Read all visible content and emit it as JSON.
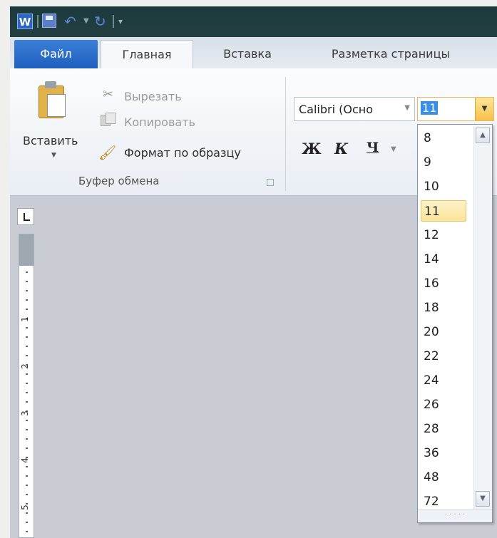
{
  "app": {
    "logo_letter": "W"
  },
  "quick_access": {
    "icons": [
      "word-logo-icon",
      "save-icon",
      "undo-icon",
      "dropdown-arrow-icon",
      "redo-icon",
      "customize-icon"
    ]
  },
  "tabs": {
    "file": "Файл",
    "home": "Главная",
    "insert": "Вставка",
    "page_layout": "Разметка страницы"
  },
  "clipboard": {
    "paste_label": "Вставить",
    "cut_label": "Вырезать",
    "copy_label": "Копировать",
    "format_painter_label": "Формат по образцу",
    "group_label": "Буфер обмена"
  },
  "font": {
    "name_value": "Calibri (Осно",
    "size_value": "11",
    "bold_label": "Ж",
    "italic_label": "К",
    "underline_label": "Ч"
  },
  "font_size_dropdown": {
    "options": [
      "8",
      "9",
      "10",
      "11",
      "12",
      "14",
      "16",
      "18",
      "20",
      "22",
      "24",
      "26",
      "28",
      "36",
      "48",
      "72"
    ],
    "selected": "11"
  },
  "ruler": {
    "numbers": [
      "1",
      "2",
      "3",
      "4",
      "5"
    ]
  },
  "colors": {
    "accent": "#1f5fbf",
    "titlebar": "#1b3a3c",
    "highlight": "#fbe49a"
  }
}
